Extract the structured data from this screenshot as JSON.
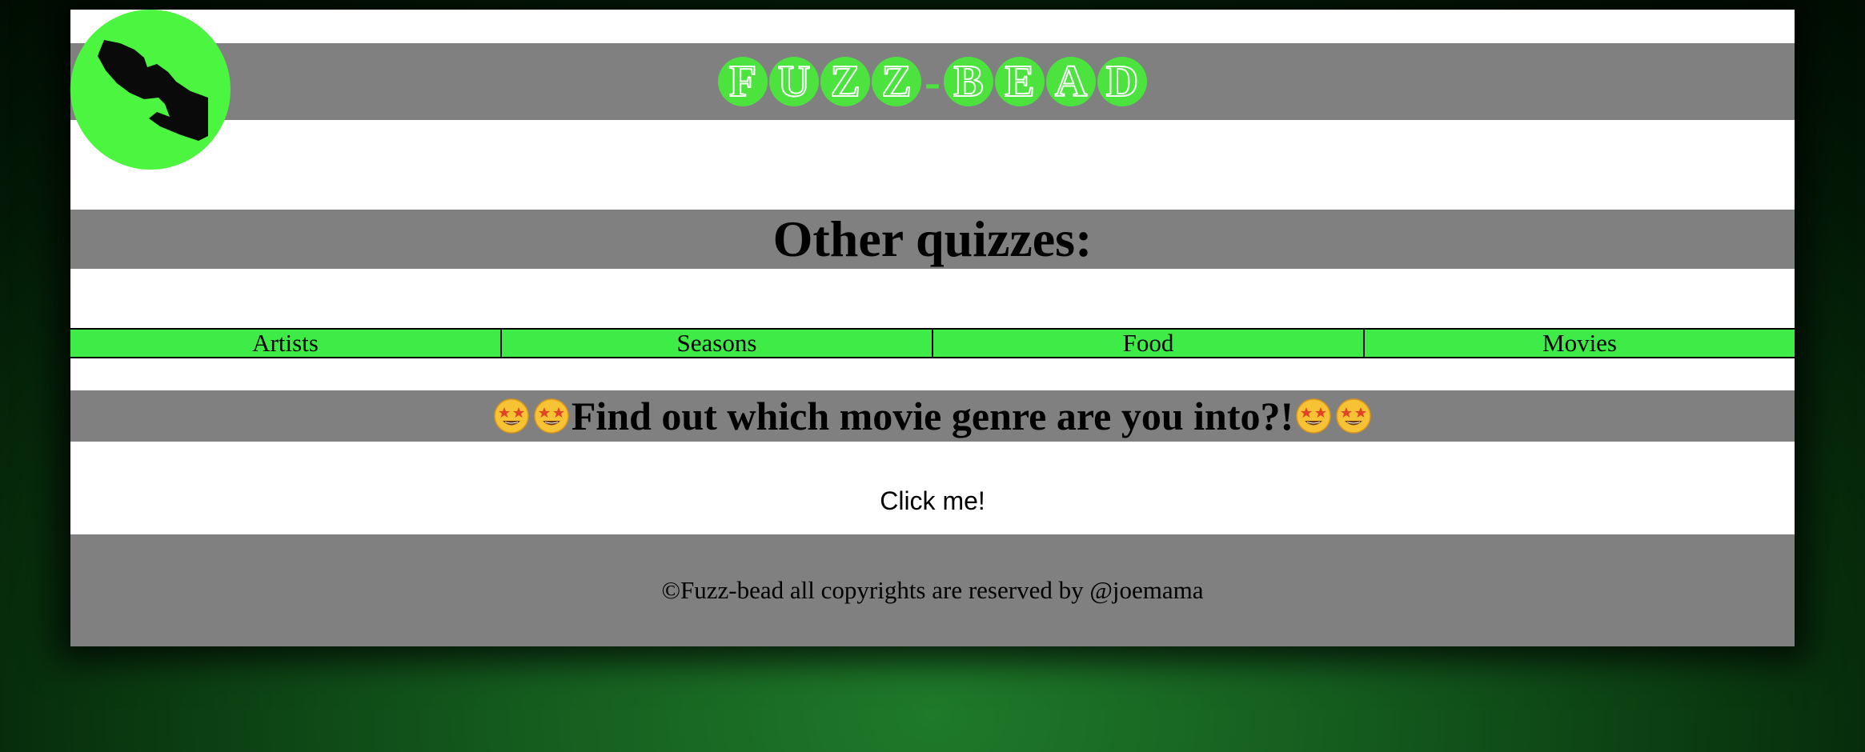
{
  "brand": {
    "letters": [
      "F",
      "U",
      "Z",
      "Z",
      "-",
      "B",
      "E",
      "A",
      "D"
    ]
  },
  "section": {
    "title": "Other quizzes:"
  },
  "nav": {
    "items": [
      {
        "label": "Artists"
      },
      {
        "label": "Seasons"
      },
      {
        "label": "Food"
      },
      {
        "label": "Movies"
      }
    ]
  },
  "quiz": {
    "headline": "Find out which movie genre are you into?!",
    "emoji_icon": "star-struck-face-icon"
  },
  "action": {
    "button_label": "Click me!"
  },
  "footer": {
    "text": "©Fuzz-bead all copyrights are reserved by @joemama"
  },
  "colors": {
    "accent_green": "#4cf53f",
    "band_gray": "#808080",
    "nav_green": "#3fec47"
  },
  "logo": {
    "icon": "downward-arrow-icon"
  }
}
